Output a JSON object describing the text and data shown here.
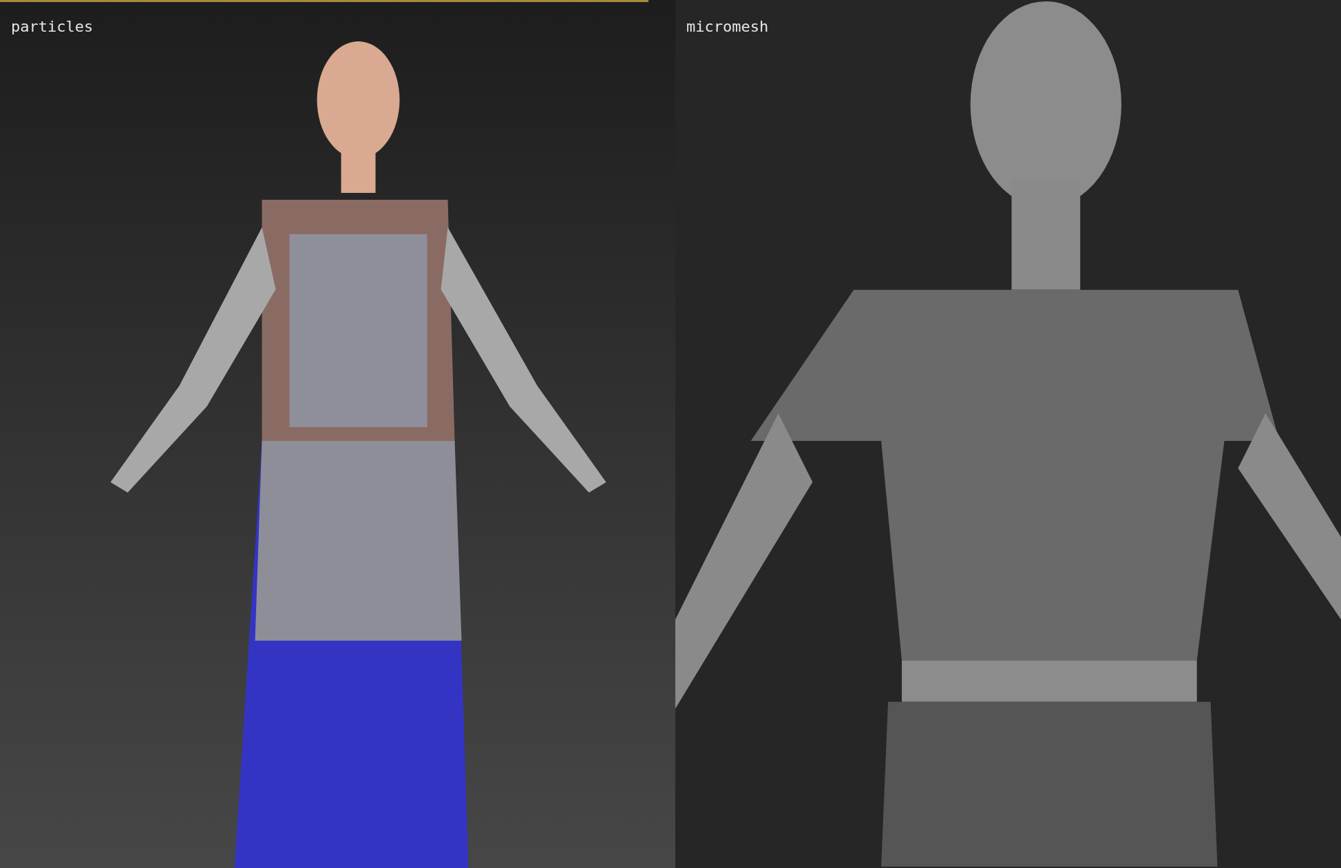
{
  "viewports": [
    {
      "label": "particles",
      "active": true,
      "kind": "dressed"
    },
    {
      "label": "micromesh",
      "active": false,
      "kind": "sculpt"
    }
  ]
}
